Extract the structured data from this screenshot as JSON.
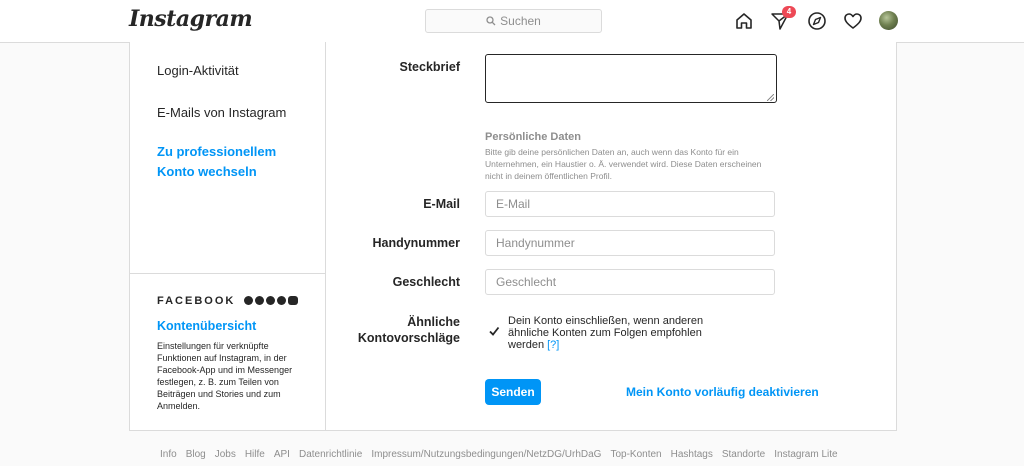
{
  "header": {
    "logo_text": "Instagram",
    "search_placeholder": "Suchen",
    "icons": [
      "home-icon",
      "direct-icon",
      "explore-icon",
      "heart-icon"
    ],
    "direct_badge": "4"
  },
  "sidebar": {
    "items": [
      {
        "label": "Login-Aktivität"
      },
      {
        "label": "E-Mails von Instagram"
      },
      {
        "label": "Zu professionellem Konto wechseln"
      }
    ],
    "facebook_label": "FACEBOOK",
    "accounts_center": "Kontenübersicht",
    "accounts_center_desc": "Einstellungen für verknüpfte Funktionen auf Instagram, in der Facebook-App und im Messenger festlegen, z. B. zum Teilen von Beiträgen und Stories und zum Anmelden."
  },
  "form": {
    "bio_label": "Steckbrief",
    "bio_value": "",
    "personal_title": "Persönliche Daten",
    "personal_desc": "Bitte gib deine persönlichen Daten an, auch wenn das Konto für ein Unternehmen, ein Haustier o. Ä. verwendet wird. Diese Daten erscheinen nicht in deinem öffentlichen Profil.",
    "email_label": "E-Mail",
    "email_placeholder": "E-Mail",
    "phone_label": "Handynummer",
    "phone_placeholder": "Handynummer",
    "gender_label": "Geschlecht",
    "gender_placeholder": "Geschlecht",
    "suggestions_label_1": "Ähnliche",
    "suggestions_label_2": "Kontovorschläge",
    "suggestions_text": "Dein Konto einschließen, wenn anderen ähnliche Konten zum Folgen empfohlen werden",
    "suggestions_help": "[?]",
    "suggestions_checked": true,
    "submit_label": "Senden",
    "deactivate_label": "Mein Konto vorläufig deaktivieren"
  },
  "footer": {
    "links": [
      "Info",
      "Blog",
      "Jobs",
      "Hilfe",
      "API",
      "Datenrichtlinie",
      "Impressum/Nutzungsbedingungen/NetzDG/UrhDaG",
      "Top-Konten",
      "Hashtags",
      "Standorte",
      "Instagram Lite"
    ]
  },
  "colors": {
    "accent": "#0095f6",
    "badge": "#ed4956",
    "border": "#dbdbdb"
  }
}
